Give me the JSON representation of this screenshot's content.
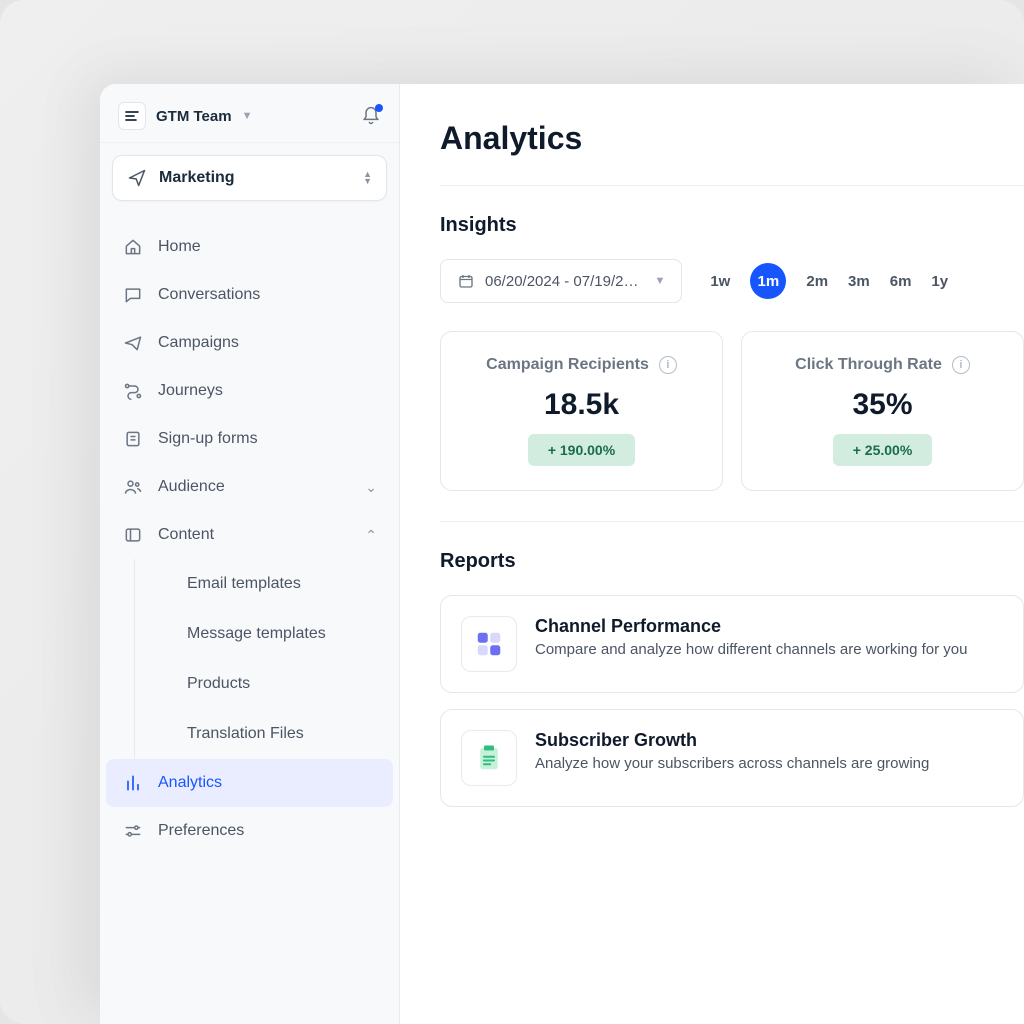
{
  "header": {
    "team": "GTM Team"
  },
  "switcher": {
    "label": "Marketing"
  },
  "nav": {
    "home": "Home",
    "conversations": "Conversations",
    "campaigns": "Campaigns",
    "journeys": "Journeys",
    "signup": "Sign-up forms",
    "audience": "Audience",
    "content": "Content",
    "analytics": "Analytics",
    "preferences": "Preferences"
  },
  "content_children": {
    "email": "Email templates",
    "message": "Message templates",
    "products": "Products",
    "translation": "Translation Files"
  },
  "page_title": "Analytics",
  "insights": {
    "title": "Insights",
    "date_range": "06/20/2024 - 07/19/2…",
    "ranges": [
      "1w",
      "1m",
      "2m",
      "3m",
      "6m",
      "1y"
    ],
    "active_range": "1m",
    "cards": {
      "recipients": {
        "title": "Campaign Recipients",
        "value": "18.5k",
        "delta": "+ 190.00%"
      },
      "ctr": {
        "title": "Click Through Rate",
        "value": "35%",
        "delta": "+ 25.00%"
      }
    }
  },
  "reports": {
    "title": "Reports",
    "channel": {
      "title": "Channel Performance",
      "desc": "Compare and analyze how different channels are working for you"
    },
    "subscriber": {
      "title": "Subscriber Growth",
      "desc": "Analyze how your subscribers across channels are growing"
    }
  }
}
